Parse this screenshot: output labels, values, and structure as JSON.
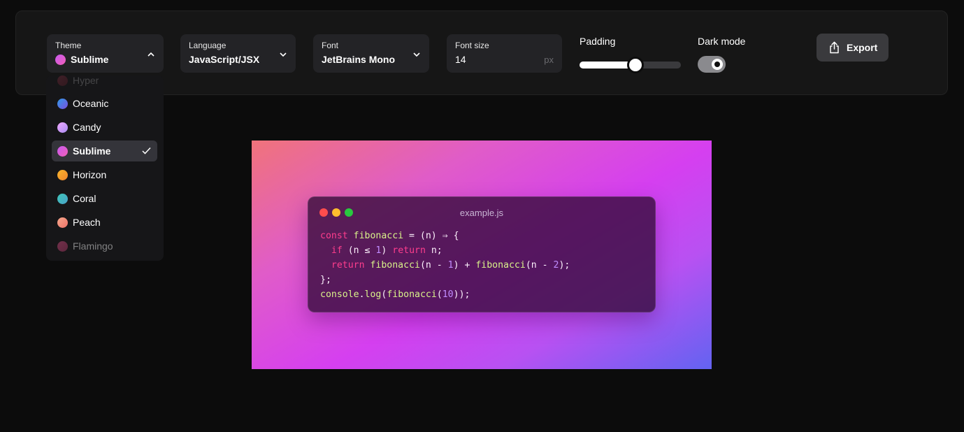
{
  "toolbar": {
    "theme": {
      "label": "Theme",
      "value": "Sublime",
      "dot_gradient": [
        "#c85af0",
        "#f25fb8"
      ]
    },
    "language": {
      "label": "Language",
      "value": "JavaScript/JSX"
    },
    "font": {
      "label": "Font",
      "value": "JetBrains Mono"
    },
    "font_size": {
      "label": "Font size",
      "value": "14",
      "unit": "px"
    },
    "padding": {
      "label": "Padding",
      "level_percent": 55
    },
    "dark_mode": {
      "label": "Dark mode",
      "on": true
    },
    "export": {
      "label": "Export",
      "icon": "share-icon"
    }
  },
  "theme_dropdown": {
    "items": [
      {
        "label": "Hyper",
        "colors": [
          "#e84a6a",
          "#a02a3a"
        ],
        "state": "partially-hidden"
      },
      {
        "label": "Oceanic",
        "colors": [
          "#2f9be8",
          "#7b4fe0"
        ]
      },
      {
        "label": "Candy",
        "colors": [
          "#f0a8ff",
          "#a98cf2"
        ]
      },
      {
        "label": "Sublime",
        "colors": [
          "#c85af0",
          "#f25fb8"
        ],
        "selected": true
      },
      {
        "label": "Horizon",
        "colors": [
          "#f8b52c",
          "#f0862c"
        ]
      },
      {
        "label": "Coral",
        "colors": [
          "#3ec6b8",
          "#4aa3c9"
        ]
      },
      {
        "label": "Peach",
        "colors": [
          "#f5a88c",
          "#ef7268"
        ]
      },
      {
        "label": "Flamingo",
        "colors": [
          "#e05088",
          "#b23b6a"
        ],
        "state": "faded"
      }
    ]
  },
  "preview": {
    "filename": "example.js",
    "window_dots": [
      "#ff4d4d",
      "#ffbd2e",
      "#29c93f"
    ],
    "code_lines": [
      [
        [
          "kw",
          "const "
        ],
        [
          "fn",
          "fibonacci"
        ],
        [
          "pl",
          " = (n) ⇒ {"
        ]
      ],
      [
        [
          "pl",
          "  "
        ],
        [
          "kw",
          "if"
        ],
        [
          "pl",
          " (n ≤ "
        ],
        [
          "num",
          "1"
        ],
        [
          "pl",
          ") "
        ],
        [
          "kw",
          "return"
        ],
        [
          "pl",
          " n;"
        ]
      ],
      [
        [
          "pl",
          "  "
        ],
        [
          "kw",
          "return "
        ],
        [
          "fn",
          "fibonacci"
        ],
        [
          "pl",
          "(n - "
        ],
        [
          "num",
          "1"
        ],
        [
          "pl",
          ") + "
        ],
        [
          "fn",
          "fibonacci"
        ],
        [
          "pl",
          "(n - "
        ],
        [
          "num",
          "2"
        ],
        [
          "pl",
          ");"
        ]
      ],
      [
        [
          "pl",
          "};"
        ]
      ],
      [
        [
          "fn",
          "console"
        ],
        [
          "pl",
          "."
        ],
        [
          "fn",
          "log"
        ],
        [
          "pl",
          "("
        ],
        [
          "fn",
          "fibonacci"
        ],
        [
          "pl",
          "("
        ],
        [
          "num",
          "10"
        ],
        [
          "pl",
          "));"
        ]
      ]
    ]
  }
}
